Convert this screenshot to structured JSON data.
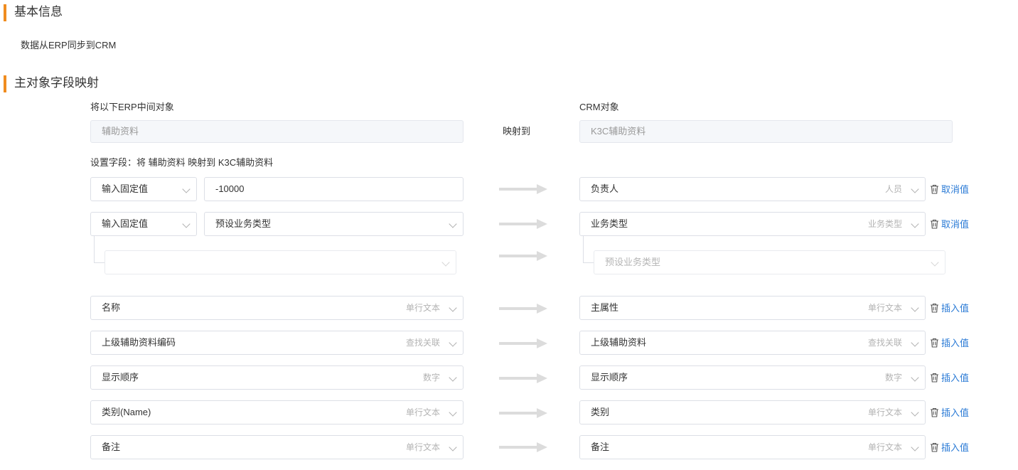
{
  "basic_info": {
    "title": "基本信息",
    "sync_direction": "数据从ERP同步到CRM"
  },
  "mapping": {
    "title": "主对象字段映射",
    "erp_label": "将以下ERP中间对象",
    "crm_label": "CRM对象",
    "erp_object": "辅助资料",
    "maps_to": "映射到",
    "crm_object": "K3C辅助资料",
    "fields_caption": "设置字段：将 辅助资料 映射到 K3C辅助资料"
  },
  "rows": [
    {
      "left_type": "输入固定值",
      "left_value": "-10000",
      "right_field": "负责人",
      "right_type": "人员",
      "action": "取消值"
    },
    {
      "left_type": "输入固定值",
      "left_value": "预设业务类型",
      "right_field": "业务类型",
      "right_type": "业务类型",
      "action": "取消值",
      "sub_left_value": "",
      "sub_right_value": "预设业务类型"
    },
    {
      "left_field": "名称",
      "left_type": "单行文本",
      "right_field": "主属性",
      "right_type": "单行文本",
      "action": "插入值"
    },
    {
      "left_field": "上级辅助资料编码",
      "left_type": "查找关联",
      "right_field": "上级辅助资料",
      "right_type": "查找关联",
      "action": "插入值"
    },
    {
      "left_field": "显示顺序",
      "left_type": "数字",
      "right_field": "显示顺序",
      "right_type": "数字",
      "action": "插入值"
    },
    {
      "left_field": "类别(Name)",
      "left_type": "单行文本",
      "right_field": "类别",
      "right_type": "单行文本",
      "action": "插入值"
    },
    {
      "left_field": "备注",
      "left_type": "单行文本",
      "right_field": "备注",
      "right_type": "单行文本",
      "action": "插入值"
    }
  ],
  "colors": {
    "accent_bar": "#f08c1f",
    "link": "#2b7bd6",
    "arrow": "#dcdcdc"
  },
  "icons": {
    "arrow": "right-arrow-icon",
    "dropdown": "chevron-down-icon",
    "delete": "trash-icon"
  }
}
